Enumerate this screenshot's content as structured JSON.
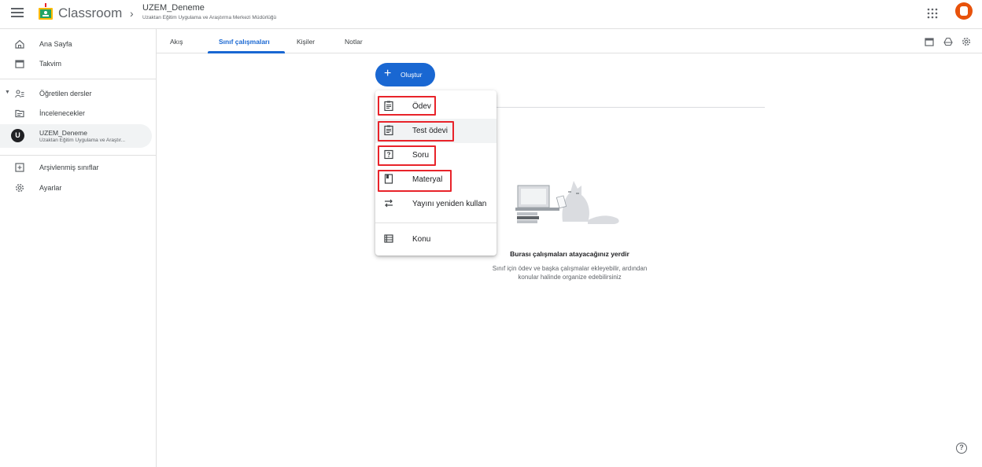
{
  "header": {
    "app_title": "Classroom",
    "crumb_separator": "›",
    "course_title": "UZEM_Deneme",
    "course_subtitle": "Uzaktan Eğitim Uygulama ve Araştırma Merkezi Müdürlüğü"
  },
  "sidebar": {
    "items": [
      {
        "label": "Ana Sayfa",
        "icon": "home-icon"
      },
      {
        "label": "Takvim",
        "icon": "calendar-icon"
      },
      {
        "label": "Öğretilen dersler",
        "icon": "people-icon"
      },
      {
        "label": "İncelenecekler",
        "icon": "folder-icon"
      },
      {
        "label": "Arşivlenmiş sınıflar",
        "icon": "archive-icon"
      },
      {
        "label": "Ayarlar",
        "icon": "gear-icon"
      }
    ],
    "active_course": {
      "initial": "U",
      "title": "UZEM_Deneme",
      "subtitle": "Uzaktan Eğitim Uygulama ve Araştır..."
    }
  },
  "tabs": [
    {
      "label": "Akış"
    },
    {
      "label": "Sınıf çalışmaları"
    },
    {
      "label": "Kişiler"
    },
    {
      "label": "Notlar"
    }
  ],
  "create_button": {
    "label": "Oluştur",
    "icon": "plus-icon"
  },
  "create_menu": {
    "items": [
      {
        "label": "Ödev",
        "icon": "assignment-icon"
      },
      {
        "label": "Test ödevi",
        "icon": "quiz-assignment-icon"
      },
      {
        "label": "Soru",
        "icon": "question-icon"
      },
      {
        "label": "Materyal",
        "icon": "material-icon"
      },
      {
        "label": "Yayını yeniden kullan",
        "icon": "reuse-icon"
      },
      {
        "label": "Konu",
        "icon": "topic-icon"
      }
    ]
  },
  "empty_state": {
    "title": "Burası çalışmaları atayacağınız yerdir",
    "description_line1": "Sınıf için ödev ve başka çalışmalar ekleyebilir, ardından",
    "description_line2": "konular halinde organize edebilirsiniz"
  },
  "colors": {
    "accent": "#1967d2",
    "highlight": "#e8232a",
    "avatar": "#e8520b"
  }
}
